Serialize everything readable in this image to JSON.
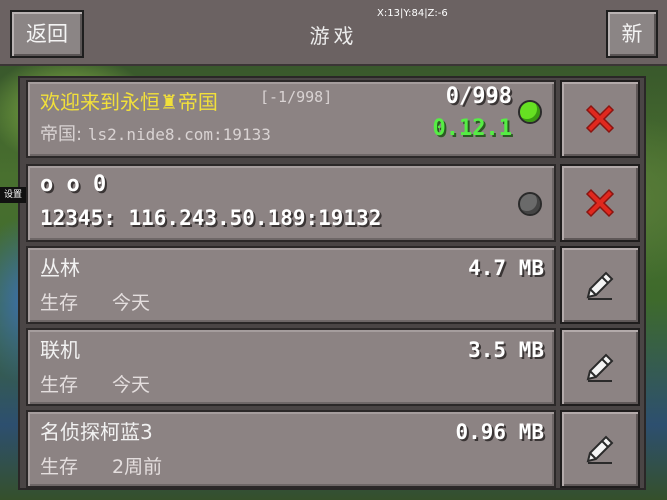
{
  "header": {
    "title": "游戏",
    "back_label": "返回",
    "new_label": "新",
    "coords": "X:13|Y:84|Z:-6"
  },
  "side_tab": {
    "label": "设置"
  },
  "servers": [
    {
      "name": "欢迎来到永恒♜帝国",
      "ping_range": "[-1/998]",
      "player_count": "0/998",
      "address_label": "帝国:",
      "address": "ls2.nide8.com:19133",
      "version": "0.12.1",
      "status": "online",
      "action": "delete-icon"
    },
    {
      "name": "o o 0",
      "address_line": "12345: 116.243.50.189:19132",
      "status": "offline",
      "action": "delete-icon"
    }
  ],
  "worlds": [
    {
      "name": "丛林",
      "size": "4.7 MB",
      "mode": "生存",
      "date": "今天",
      "action": "edit-icon"
    },
    {
      "name": "联机",
      "size": "3.5 MB",
      "mode": "生存",
      "date": "今天",
      "action": "edit-icon"
    },
    {
      "name": "名侦探柯蓝3",
      "size": "0.96 MB",
      "mode": "生存",
      "date": "2周前",
      "action": "edit-icon"
    }
  ],
  "colors": {
    "header": "#6b6262",
    "row": "#8c8383",
    "server_name_yellow": "#f2e03a",
    "version_green": "#55ee44",
    "online_dot": "#66e022",
    "offline_dot": "#6a6a6a",
    "delete_red": "#e0281e"
  }
}
